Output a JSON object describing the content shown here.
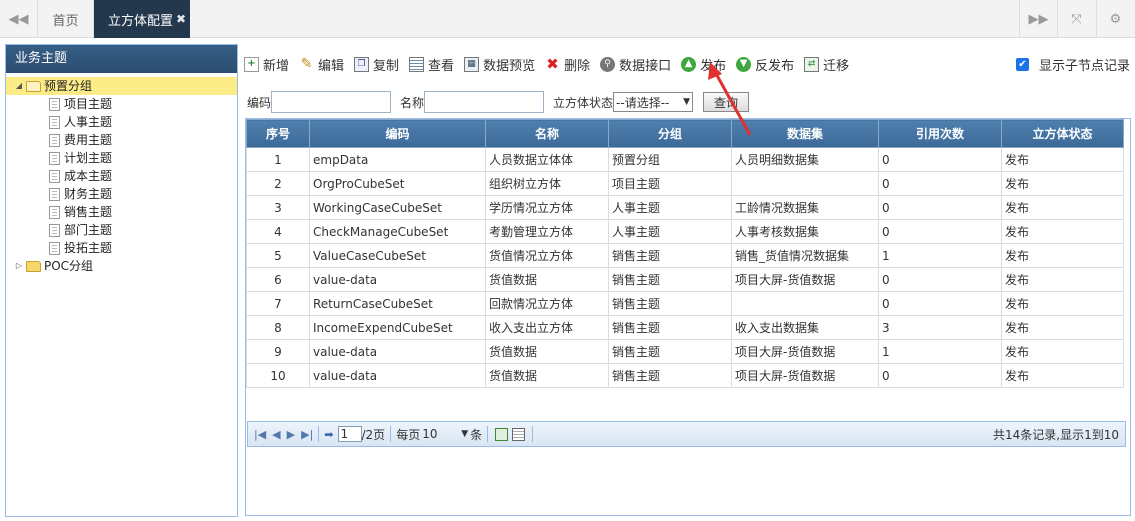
{
  "tabs": {
    "home_label": "首页",
    "active_label": "立方体配置",
    "close_glyph": "✖"
  },
  "sidebar": {
    "title": "业务主题",
    "tree": [
      {
        "label": "预置分组",
        "expanded": true,
        "selected": true,
        "children": [
          "项目主题",
          "人事主题",
          "费用主题",
          "计划主题",
          "成本主题",
          "财务主题",
          "销售主题",
          "部门主题",
          "投拓主题"
        ]
      },
      {
        "label": "POC分组",
        "expanded": false,
        "selected": false,
        "children": []
      }
    ]
  },
  "toolbar": {
    "new": "新增",
    "edit": "编辑",
    "copy": "复制",
    "view": "查看",
    "preview": "数据预览",
    "delete": "删除",
    "api": "数据接口",
    "publish": "发布",
    "unpublish": "反发布",
    "migrate": "迁移",
    "show_child": "显示子节点记录"
  },
  "search": {
    "code_label": "编码",
    "code_value": "",
    "name_label": "名称",
    "name_value": "",
    "status_label": "立方体状态",
    "status_value": "--请选择--",
    "query_label": "查询"
  },
  "table": {
    "columns": [
      "序号",
      "编码",
      "名称",
      "分组",
      "数据集",
      "引用次数",
      "立方体状态"
    ],
    "rows": [
      [
        "1",
        "empData",
        "人员数据立体体",
        "预置分组",
        "人员明细数据集",
        "0",
        "发布"
      ],
      [
        "2",
        "OrgProCubeSet",
        "组织树立方体",
        "项目主题",
        "",
        "0",
        "发布"
      ],
      [
        "3",
        "WorkingCaseCubeSet",
        "学历情况立方体",
        "人事主题",
        "工龄情况数据集",
        "0",
        "发布"
      ],
      [
        "4",
        "CheckManageCubeSet",
        "考勤管理立方体",
        "人事主题",
        "人事考核数据集",
        "0",
        "发布"
      ],
      [
        "5",
        "ValueCaseCubeSet",
        "货值情况立方体",
        "销售主题",
        "销售_货值情况数据集",
        "1",
        "发布"
      ],
      [
        "6",
        "value-data",
        "货值数据",
        "销售主题",
        "项目大屏-货值数据",
        "0",
        "发布"
      ],
      [
        "7",
        "ReturnCaseCubeSet",
        "回款情况立方体",
        "销售主题",
        "",
        "0",
        "发布"
      ],
      [
        "8",
        "IncomeExpendCubeSet",
        "收入支出立方体",
        "销售主题",
        "收入支出数据集",
        "3",
        "发布"
      ],
      [
        "9",
        "value-data",
        "货值数据",
        "销售主题",
        "项目大屏-货值数据",
        "1",
        "发布"
      ],
      [
        "10",
        "value-data",
        "货值数据",
        "销售主题",
        "项目大屏-货值数据",
        "0",
        "发布"
      ]
    ]
  },
  "pager": {
    "page_value": "1",
    "total_pages": "/2页",
    "per_page_label": "每页",
    "per_page_value": "10",
    "unit": "条",
    "summary": "共14条记录,显示1到10"
  },
  "colors": {
    "accent": "#23374d",
    "header_blue": "#3c6a98",
    "tree_selected": "#fbec88",
    "annotation_arrow": "#e03030"
  }
}
